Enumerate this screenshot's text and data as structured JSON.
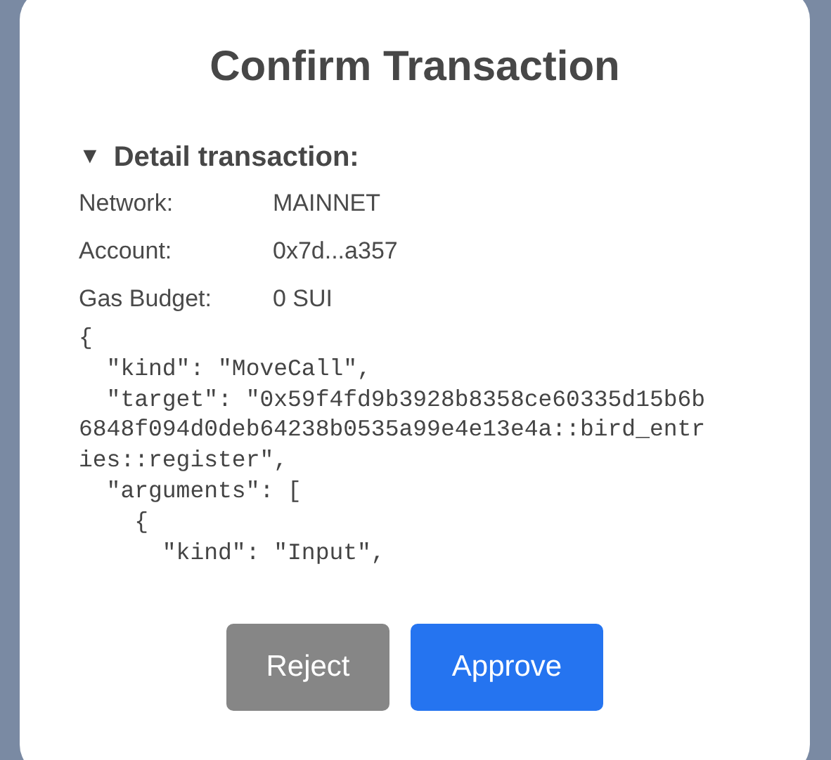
{
  "dialog": {
    "title": "Confirm Transaction"
  },
  "details": {
    "expanded": true,
    "toggle": "▼",
    "heading": "Detail transaction:",
    "rows": [
      {
        "label": "Network:",
        "value": "MAINNET"
      },
      {
        "label": "Account:",
        "value": "0x7d...a357"
      },
      {
        "label": "Gas Budget:",
        "value": "0 SUI"
      }
    ],
    "code_lines": [
      "{",
      "  \"kind\": \"MoveCall\",",
      "  \"target\": \"0x59f4fd9b3928b8358ce60335d15b6b",
      "6848f094d0deb64238b0535a99e4e13e4a::bird_entr",
      "ies::register\",",
      "  \"arguments\": [",
      "    {",
      "      \"kind\": \"Input\","
    ]
  },
  "buttons": [
    {
      "label": "Reject",
      "kind": "secondary"
    },
    {
      "label": "Approve",
      "kind": "primary"
    }
  ]
}
